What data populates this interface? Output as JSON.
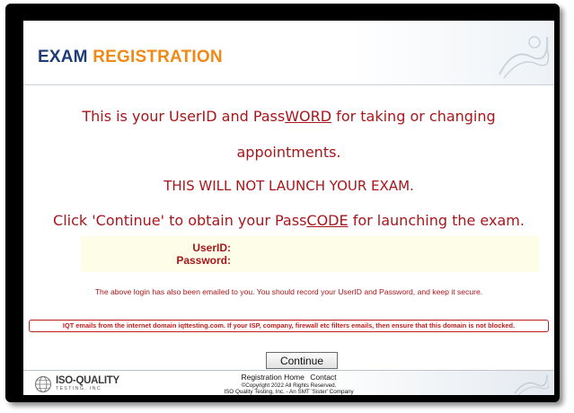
{
  "header": {
    "title_part1": "EXAM",
    "title_part2": "REGISTRATION"
  },
  "messages": {
    "line1_pre": "This is your UserID and Pass",
    "line1_underlined": "WORD",
    "line1_post": " for taking or changing",
    "line2": "appointments.",
    "line3": "THIS WILL NOT LAUNCH YOUR EXAM.",
    "line4_pre": "Click 'Continue' to obtain your Pass",
    "line4_underlined": "CODE",
    "line4_post": " for launching the exam."
  },
  "credentials": {
    "userid_label": "UserID:",
    "userid_value": "",
    "password_label": "Password:",
    "password_value": ""
  },
  "note": "The above login has also been emailed to you. You should record your UserID and Password, and keep it secure.",
  "warning": "IQT emails from the internet domain iqttesting.com. If your ISP, company, firewall etc filters emails, then ensure that this domain is not blocked.",
  "continue_label": "Continue",
  "footer": {
    "logo_text": "ISO-QUALITY",
    "logo_sub": "TESTING, INC",
    "link_home": "Registration Home",
    "link_contact": "Contact",
    "copyright": "©Copyright 2022 All Rights Reserved.",
    "company": "ISO Quality Testing, Inc. - An SMT 'Sister' Company"
  },
  "colors": {
    "title_blue": "#1d3c78",
    "title_orange": "#f08a16",
    "message_red": "#a8161b",
    "credentials_bg": "#fefde8"
  }
}
